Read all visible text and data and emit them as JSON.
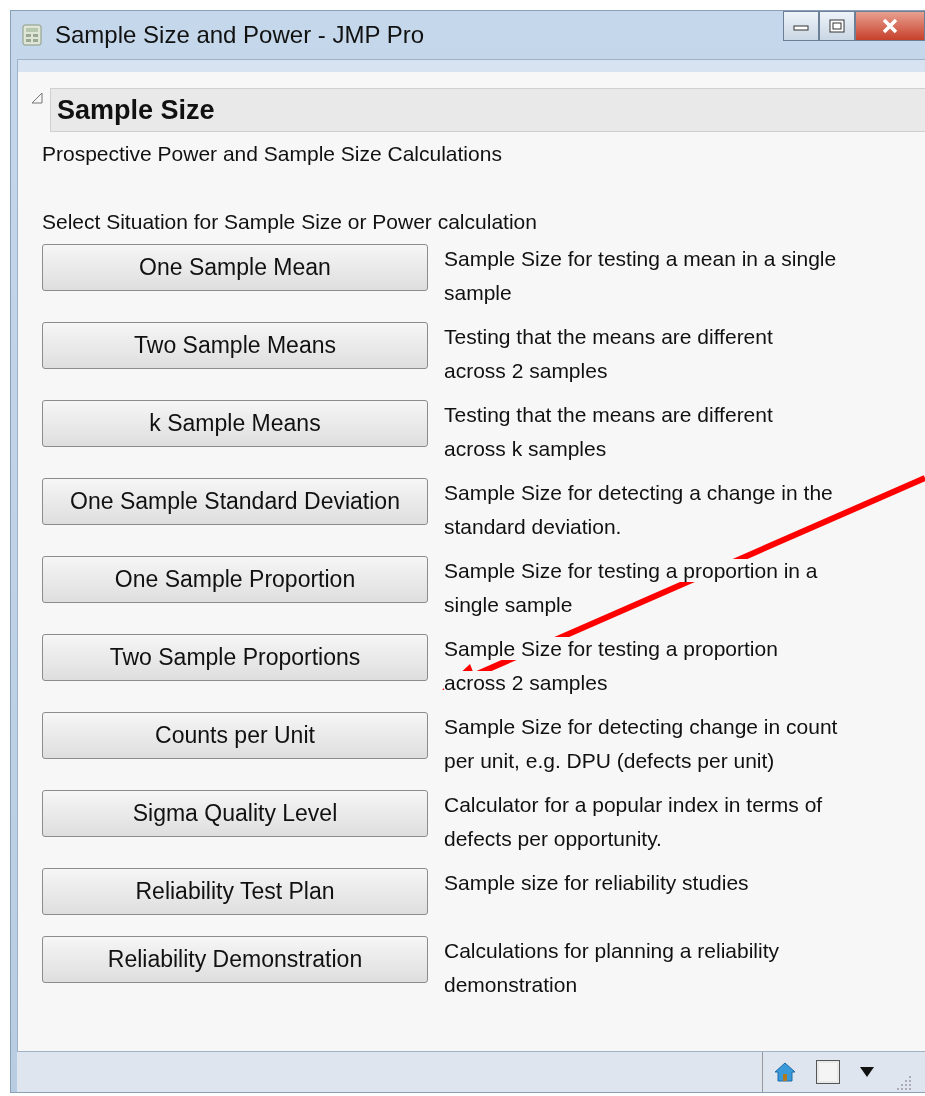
{
  "window": {
    "title": "Sample Size and Power - JMP Pro"
  },
  "section": {
    "title": "Sample Size",
    "expanded": true
  },
  "subtitle": "Prospective Power and Sample Size Calculations",
  "instruction": "Select Situation for Sample Size or Power calculation",
  "options": [
    {
      "button": "One Sample Mean",
      "description": "Sample Size for testing a mean in a single\nsample"
    },
    {
      "button": "Two Sample Means",
      "description": "Testing that the means are different\nacross 2 samples"
    },
    {
      "button": "k Sample Means",
      "description": "Testing that the means are different\nacross k samples"
    },
    {
      "button": "One Sample Standard Deviation",
      "description": "Sample Size for detecting a change in the\nstandard deviation."
    },
    {
      "button": "One Sample Proportion",
      "description": "Sample Size for testing a proportion in a\nsingle sample"
    },
    {
      "button": "Two Sample Proportions",
      "description": "Sample Size for testing a proportion\nacross 2 samples"
    },
    {
      "button": "Counts per Unit",
      "description": "Sample Size for detecting change in count\nper unit, e.g. DPU (defects per unit)"
    },
    {
      "button": "Sigma Quality Level",
      "description": "Calculator for a popular index in terms of\ndefects per opportunity."
    },
    {
      "button": "Reliability Test Plan",
      "description": "Sample size for reliability studies"
    },
    {
      "button": "Reliability Demonstration",
      "description": "Calculations for planning a reliability\ndemonstration"
    }
  ]
}
